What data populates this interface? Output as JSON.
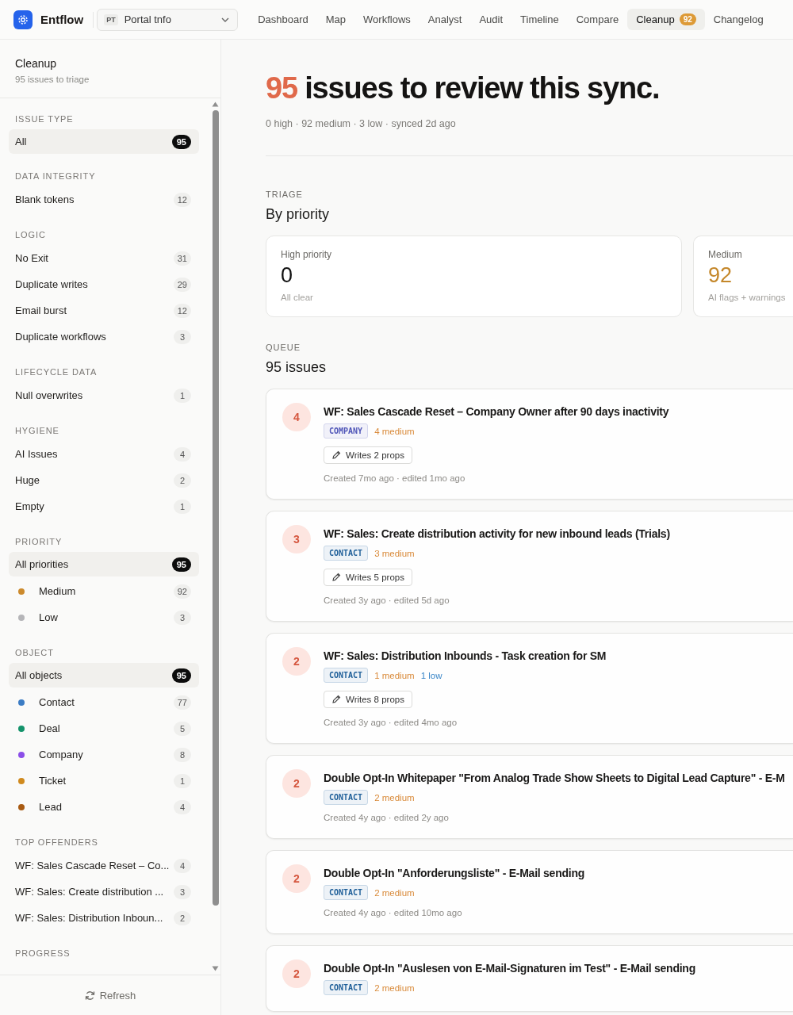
{
  "header": {
    "brand": "Entflow",
    "project": {
      "initials": "PT",
      "name": "Portal tnfo"
    },
    "tabs": [
      {
        "label": "Dashboard",
        "selected": false
      },
      {
        "label": "Map",
        "selected": false
      },
      {
        "label": "Workflows",
        "selected": false
      },
      {
        "label": "Analyst",
        "selected": false
      },
      {
        "label": "Audit",
        "selected": false
      },
      {
        "label": "Timeline",
        "selected": false
      },
      {
        "label": "Compare",
        "selected": false
      },
      {
        "label": "Cleanup",
        "selected": true,
        "badge": "92"
      },
      {
        "label": "Changelog",
        "selected": false
      }
    ]
  },
  "sidebar": {
    "title": "Cleanup",
    "subtitle": "95 issues to triage",
    "sections": [
      {
        "label": "ISSUE TYPE",
        "items": [
          {
            "label": "All",
            "count": "95",
            "selected": true
          }
        ]
      },
      {
        "label": "DATA INTEGRITY",
        "items": [
          {
            "label": "Blank tokens",
            "count": "12",
            "selected": false
          }
        ]
      },
      {
        "label": "LOGIC",
        "items": [
          {
            "label": "No Exit",
            "count": "31",
            "selected": false
          },
          {
            "label": "Duplicate writes",
            "count": "29",
            "selected": false
          },
          {
            "label": "Email burst",
            "count": "12",
            "selected": false
          },
          {
            "label": "Duplicate workflows",
            "count": "3",
            "selected": false
          }
        ]
      },
      {
        "label": "LIFECYCLE DATA",
        "items": [
          {
            "label": "Null overwrites",
            "count": "1",
            "selected": false
          }
        ]
      },
      {
        "label": "HYGIENE",
        "items": [
          {
            "label": "AI Issues",
            "count": "4",
            "selected": false
          },
          {
            "label": "Huge",
            "count": "2",
            "selected": false
          },
          {
            "label": "Empty",
            "count": "1",
            "selected": false
          }
        ]
      },
      {
        "label": "PRIORITY",
        "items": [
          {
            "label": "All priorities",
            "count": "95",
            "selected": true
          },
          {
            "label": "Medium",
            "count": "92",
            "selected": false,
            "color": "#cc8a2c"
          },
          {
            "label": "Low",
            "count": "3",
            "selected": false,
            "color": "#b5b5b8"
          }
        ]
      },
      {
        "label": "OBJECT",
        "items": [
          {
            "label": "All objects",
            "count": "95",
            "selected": true
          },
          {
            "label": "Contact",
            "count": "77",
            "selected": false,
            "color": "#3b7cc4"
          },
          {
            "label": "Deal",
            "count": "5",
            "selected": false,
            "color": "#14936b"
          },
          {
            "label": "Company",
            "count": "8",
            "selected": false,
            "color": "#8b4ee8"
          },
          {
            "label": "Ticket",
            "count": "1",
            "selected": false,
            "color": "#d08a1e"
          },
          {
            "label": "Lead",
            "count": "4",
            "selected": false,
            "color": "#a85a12"
          }
        ]
      },
      {
        "label": "TOP OFFENDERS",
        "items": [
          {
            "label": "WF: Sales Cascade Reset – Co...",
            "count": "4",
            "selected": false
          },
          {
            "label": "WF: Sales: Create distribution ...",
            "count": "3",
            "selected": false
          },
          {
            "label": "WF: Sales: Distribution Inboun...",
            "count": "2",
            "selected": false
          }
        ]
      },
      {
        "label": "PROGRESS"
      }
    ],
    "refresh": "Refresh"
  },
  "hero": {
    "count": "95",
    "title": " issues to review this sync.",
    "meta": "0 high · 92 medium · 3 low · synced 2d ago"
  },
  "triage": {
    "label": "TRIAGE",
    "heading": "By priority",
    "stats": [
      {
        "label": "High priority",
        "value": "0",
        "note": "All clear",
        "color": "#111111"
      },
      {
        "label": "Medium",
        "value": "92",
        "note": "AI flags + warnings",
        "color": "#c4872a"
      }
    ]
  },
  "queue": {
    "label": "QUEUE",
    "heading": "95 issues",
    "issues": [
      {
        "count": "4",
        "title": "WF: Sales Cascade Reset – Company Owner after 90 days inactivity",
        "tag": {
          "label": "COMPANY",
          "color": "#4f55b8"
        },
        "severities": [
          {
            "text": "4 medium",
            "kind": "medium"
          }
        ],
        "writes": "Writes 2 props",
        "meta": "Created 7mo ago · edited 1mo ago"
      },
      {
        "count": "3",
        "title": "WF: Sales: Create distribution activity for new inbound leads (Trials)",
        "tag": {
          "label": "CONTACT",
          "color": "#1f5f99"
        },
        "severities": [
          {
            "text": "3 medium",
            "kind": "medium"
          }
        ],
        "writes": "Writes 5 props",
        "meta": "Created 3y ago · edited 5d ago"
      },
      {
        "count": "2",
        "title": "WF: Sales: Distribution Inbounds - Task creation for SM",
        "tag": {
          "label": "CONTACT",
          "color": "#1f5f99"
        },
        "severities": [
          {
            "text": "1 medium",
            "kind": "medium"
          },
          {
            "text": "1 low",
            "kind": "low"
          }
        ],
        "writes": "Writes 8 props",
        "meta": "Created 3y ago · edited 4mo ago"
      },
      {
        "count": "2",
        "title": "Double Opt-In Whitepaper \"From Analog Trade Show Sheets to Digital Lead Capture\" - E-M",
        "tag": {
          "label": "CONTACT",
          "color": "#1f5f99"
        },
        "severities": [
          {
            "text": "2 medium",
            "kind": "medium"
          }
        ],
        "meta": "Created 4y ago · edited 2y ago"
      },
      {
        "count": "2",
        "title": "Double Opt-In \"Anforderungsliste\" - E-Mail sending",
        "tag": {
          "label": "CONTACT",
          "color": "#1f5f99"
        },
        "severities": [
          {
            "text": "2 medium",
            "kind": "medium"
          }
        ],
        "meta": "Created 4y ago · edited 10mo ago"
      },
      {
        "count": "2",
        "title": "Double Opt-In \"Auslesen von E-Mail-Signaturen im Test\" - E-Mail sending",
        "tag": {
          "label": "CONTACT",
          "color": "#1f5f99"
        },
        "severities": [
          {
            "text": "2 medium",
            "kind": "medium"
          }
        ]
      }
    ]
  }
}
